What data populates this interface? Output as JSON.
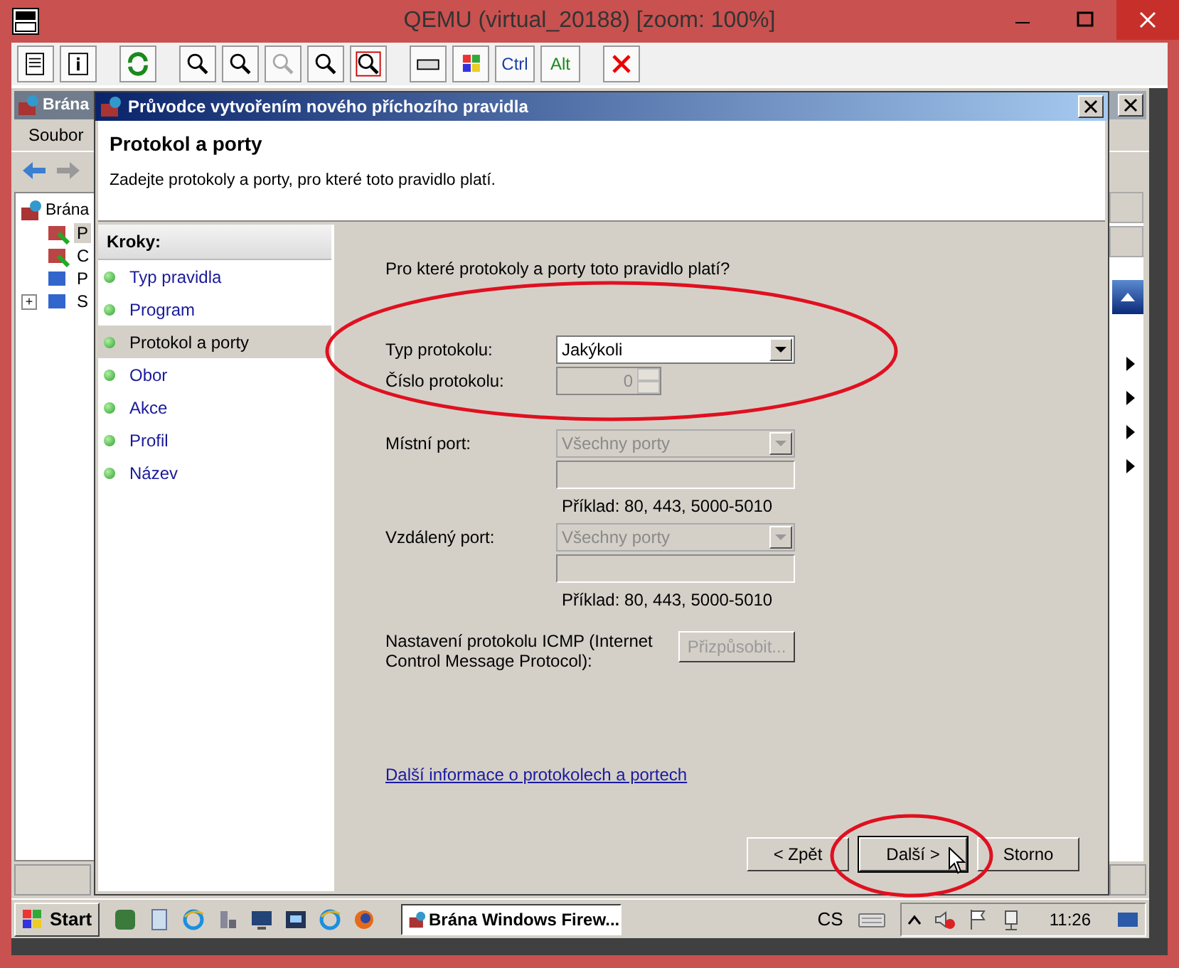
{
  "window": {
    "title": "QEMU (virtual_20188) [zoom: 100%]"
  },
  "vnc_toolbar": {
    "zoom_buttons": [
      {
        "disabled": false
      },
      {
        "disabled": false
      },
      {
        "disabled": true
      },
      {
        "disabled": false
      },
      {
        "disabled": false
      }
    ],
    "key_buttons": [
      "Ctrl",
      "Alt"
    ]
  },
  "background_window": {
    "title": "Brána",
    "menu": [
      "Soubor"
    ],
    "tree": [
      {
        "label": "Brána",
        "children": [
          {
            "label": "P",
            "selected": true
          },
          {
            "label": "C",
            "selected": false
          },
          {
            "label": "P",
            "selected": false
          },
          {
            "label": "S",
            "selected": false,
            "expander": "+"
          }
        ]
      }
    ]
  },
  "dialog": {
    "title": "Průvodce vytvořením nového příchozího pravidla",
    "heading": "Protokol a porty",
    "subtitle": "Zadejte protokoly a porty, pro které toto pravidlo platí.",
    "steps_header": "Kroky:",
    "steps": [
      {
        "label": "Typ pravidla",
        "selected": false
      },
      {
        "label": "Program",
        "selected": false
      },
      {
        "label": "Protokol a porty",
        "selected": true
      },
      {
        "label": "Obor",
        "selected": false
      },
      {
        "label": "Akce",
        "selected": false
      },
      {
        "label": "Profil",
        "selected": false
      },
      {
        "label": "Název",
        "selected": false
      }
    ],
    "question": "Pro které protokoly a porty toto pravidlo platí?",
    "protocol_type": {
      "label": "Typ protokolu:",
      "value": "Jakýkoli",
      "disabled": false
    },
    "protocol_number": {
      "label": "Číslo protokolu:",
      "value": "0",
      "disabled": true
    },
    "local_port": {
      "label": "Místní port:",
      "value": "Všechny porty",
      "disabled": true,
      "example": "Příklad: 80, 443, 5000-5010"
    },
    "remote_port": {
      "label": "Vzdálený port:",
      "value": "Všechny porty",
      "disabled": true,
      "example": "Příklad: 80, 443, 5000-5010"
    },
    "icmp": {
      "label": "Nastavení protokolu ICMP (Internet Control Message Protocol):",
      "button": "Přizpůsobit...",
      "disabled": true
    },
    "link": "Další informace o protokolech a portech",
    "buttons": [
      {
        "label": "< Zpět",
        "default": false
      },
      {
        "label": "Další >",
        "default": true
      },
      {
        "label": "Storno",
        "default": false
      }
    ]
  },
  "taskbar": {
    "start": "Start",
    "task": "Brána Windows Firew...",
    "language": "CS",
    "clock": "11:26"
  }
}
